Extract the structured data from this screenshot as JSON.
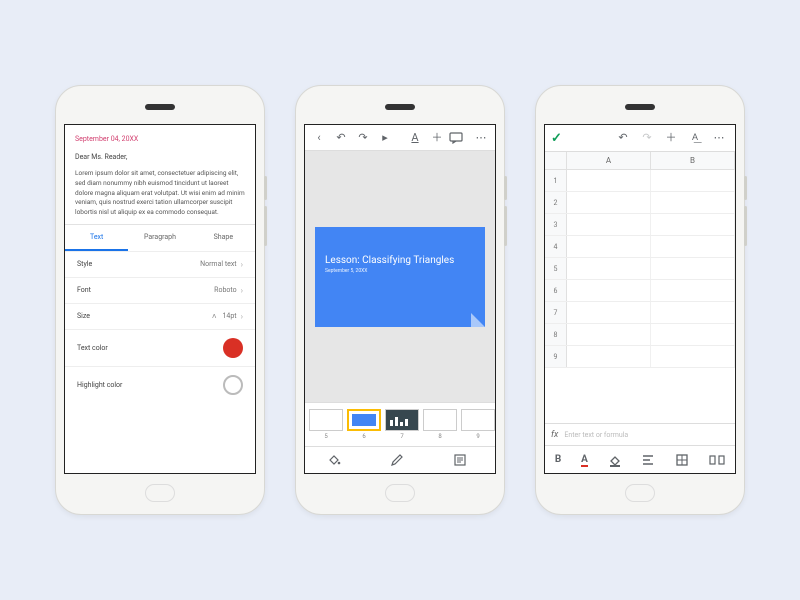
{
  "docs": {
    "date": "September 04, 20XX",
    "greeting": "Dear Ms. Reader,",
    "body": "Lorem ipsum dolor sit amet, consectetuer adipiscing elit, sed diam nonummy nibh euismod tincidunt ut laoreet dolore magna aliquam erat volutpat. Ut wisi enim ad minim veniam, quis nostrud exerci tation ullamcorper suscipit lobortis nisl ut aliquip ex ea commodo consequat.",
    "tabs": {
      "text": "Text",
      "paragraph": "Paragraph",
      "shape": "Shape"
    },
    "rows": {
      "style_label": "Style",
      "style_value": "Normal text",
      "font_label": "Font",
      "font_value": "Roboto",
      "size_label": "Size",
      "size_value": "14pt",
      "textcolor_label": "Text color",
      "highlight_label": "Highlight color"
    }
  },
  "slides": {
    "slide_title": "Lesson: Classifying Triangles",
    "slide_subtitle": "September 5, 20XX",
    "thumb_numbers": [
      "5",
      "6",
      "7",
      "8",
      "9"
    ]
  },
  "sheets": {
    "columns": [
      "A",
      "B"
    ],
    "rows": [
      "1",
      "2",
      "3",
      "4",
      "5",
      "6",
      "7",
      "8",
      "9"
    ],
    "fx_label": "fx",
    "formula_placeholder": "Enter text or formula",
    "fmt": {
      "bold": "B",
      "textcolor": "A",
      "fillcolor": "A"
    }
  }
}
